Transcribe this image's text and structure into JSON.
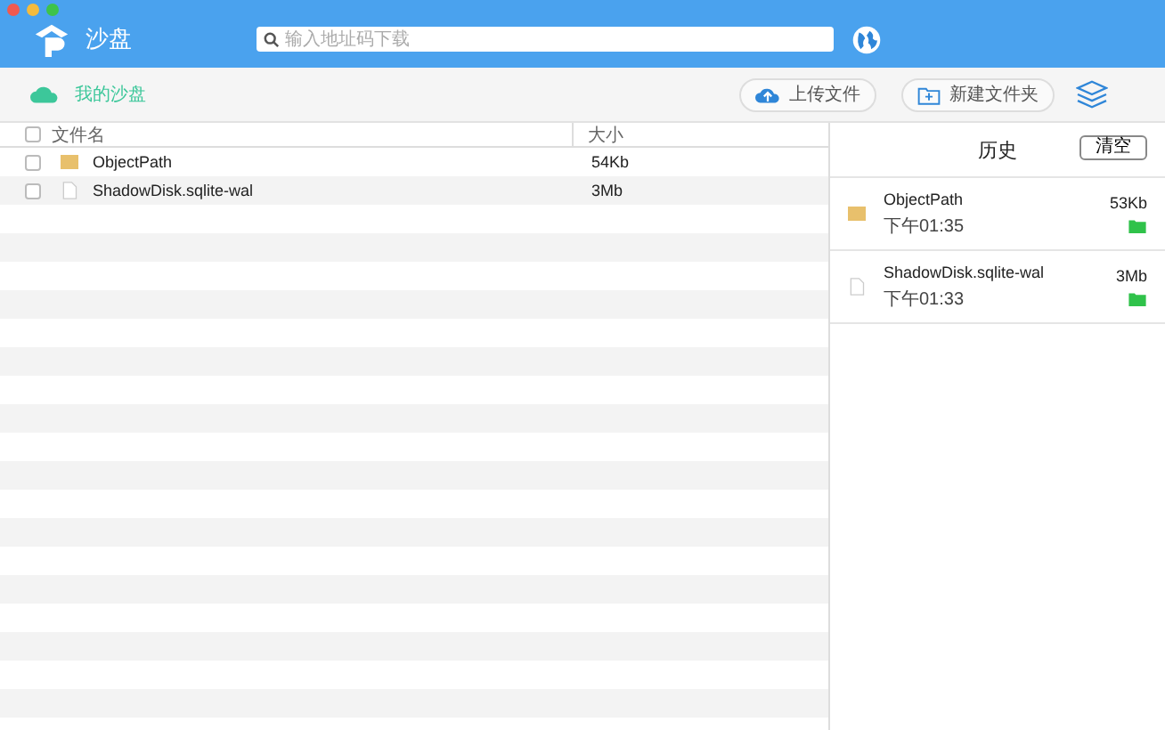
{
  "app": {
    "title": "沙盘"
  },
  "search": {
    "placeholder": "输入地址码下载"
  },
  "toolbar": {
    "location": "我的沙盘",
    "buttons": [
      "上传文件",
      "新建文件夹"
    ]
  },
  "table": {
    "columns": [
      "文件名",
      "大小"
    ],
    "header_checked": false,
    "rows": [
      {
        "kind": "folder",
        "name": "ObjectPath",
        "size": "54Kb",
        "checked": false
      },
      {
        "kind": "file",
        "name": "ShadowDisk.sqlite-wal",
        "size": "3Mb",
        "checked": false
      }
    ]
  },
  "history": {
    "title": "历史",
    "clear_button": "清空",
    "items": [
      {
        "kind": "folder",
        "name": "ObjectPath",
        "time": "下午01:35",
        "size": "53Kb"
      },
      {
        "kind": "file",
        "name": "ShadowDisk.sqlite-wal",
        "time": "下午01:33",
        "size": "3Mb"
      }
    ]
  }
}
